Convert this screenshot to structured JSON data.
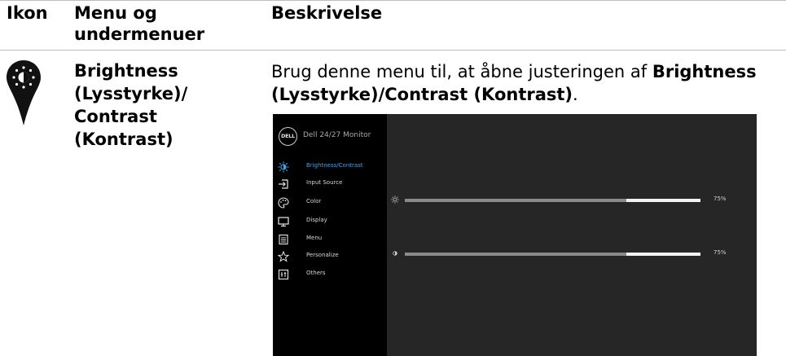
{
  "table": {
    "headers": {
      "icon": "Ikon",
      "menu": "Menu og undermenuer",
      "description": "Beskrivelse"
    },
    "row": {
      "menu_name": "Brightness (Lysstyrke)/ Contrast (Kontrast)",
      "desc_prefix": "Brug denne menu til, at åbne justeringen af ",
      "desc_bold": "Brightness (Lysstyrke)/Contrast (Kontrast)",
      "desc_suffix": "."
    }
  },
  "osd": {
    "logo_text": "DELL",
    "title": "Dell 24/27 Monitor",
    "menu_items": [
      {
        "label": "Brightness/Contrast",
        "icon": "brightness-icon",
        "active": true
      },
      {
        "label": "Input Source",
        "icon": "input-source-icon",
        "active": false
      },
      {
        "label": "Color",
        "icon": "color-palette-icon",
        "active": false
      },
      {
        "label": "Display",
        "icon": "display-monitor-icon",
        "active": false
      },
      {
        "label": "Menu",
        "icon": "menu-list-icon",
        "active": false
      },
      {
        "label": "Personalize",
        "icon": "star-icon",
        "active": false
      },
      {
        "label": "Others",
        "icon": "others-icon",
        "active": false
      }
    ],
    "sliders": [
      {
        "name": "brightness",
        "icon": "sun-icon",
        "value": 0.75,
        "value_label": "75%"
      },
      {
        "name": "contrast",
        "icon": "contrast-icon",
        "value": 0.75,
        "value_label": "75%"
      }
    ],
    "colors": {
      "active": "#3fa6ec",
      "panel": "#262626",
      "sidebar": "#000000"
    }
  }
}
